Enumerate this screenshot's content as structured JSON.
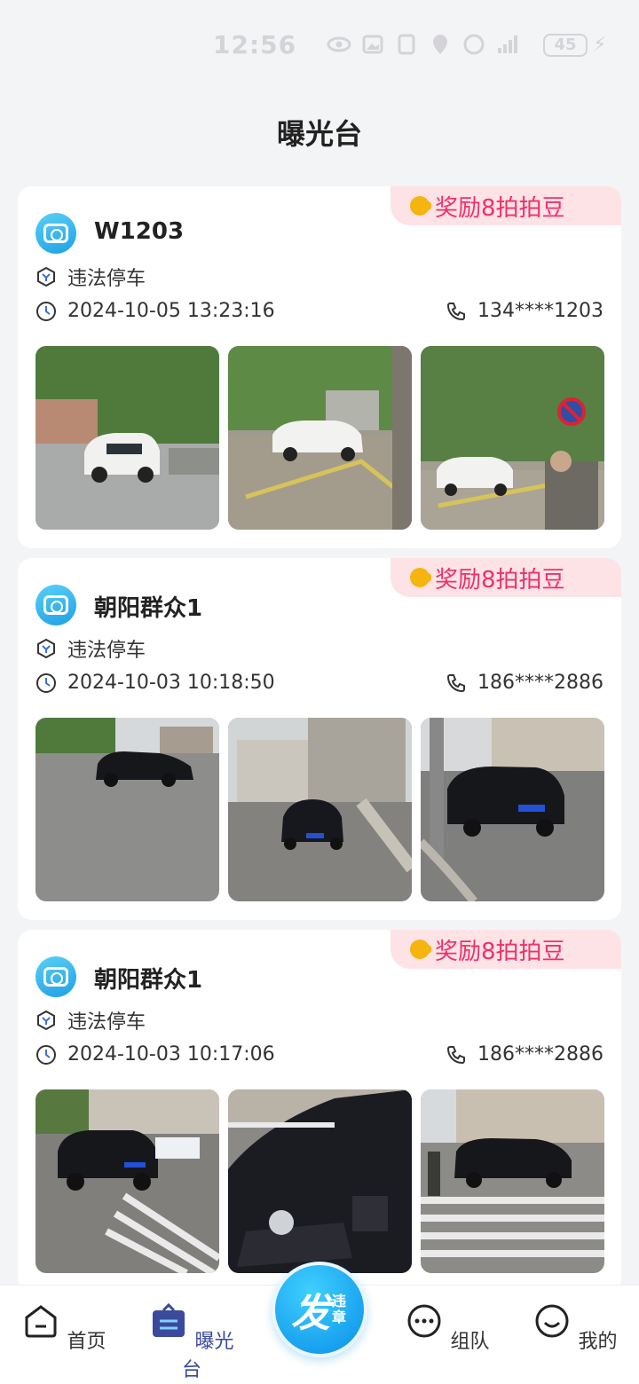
{
  "status_bar": {
    "time": "12:56",
    "battery": "45"
  },
  "header": {
    "title": "曝光台"
  },
  "cards": [
    {
      "reward": "奖励8拍拍豆",
      "user": "W1203",
      "type": "违法停车",
      "datetime": "2024-10-05 13:23:16",
      "phone": "134****1203"
    },
    {
      "reward": "奖励8拍拍豆",
      "user": "朝阳群众1",
      "type": "违法停车",
      "datetime": "2024-10-03 10:18:50",
      "phone": "186****2886"
    },
    {
      "reward": "奖励8拍拍豆",
      "user": "朝阳群众1",
      "type": "违法停车",
      "datetime": "2024-10-03 10:17:06",
      "phone": "186****2886"
    }
  ],
  "tabbar": {
    "home": "首页",
    "expose": "曝光台",
    "publish_big": "发",
    "publish_small": "违章",
    "team": "组队",
    "me": "我的"
  }
}
